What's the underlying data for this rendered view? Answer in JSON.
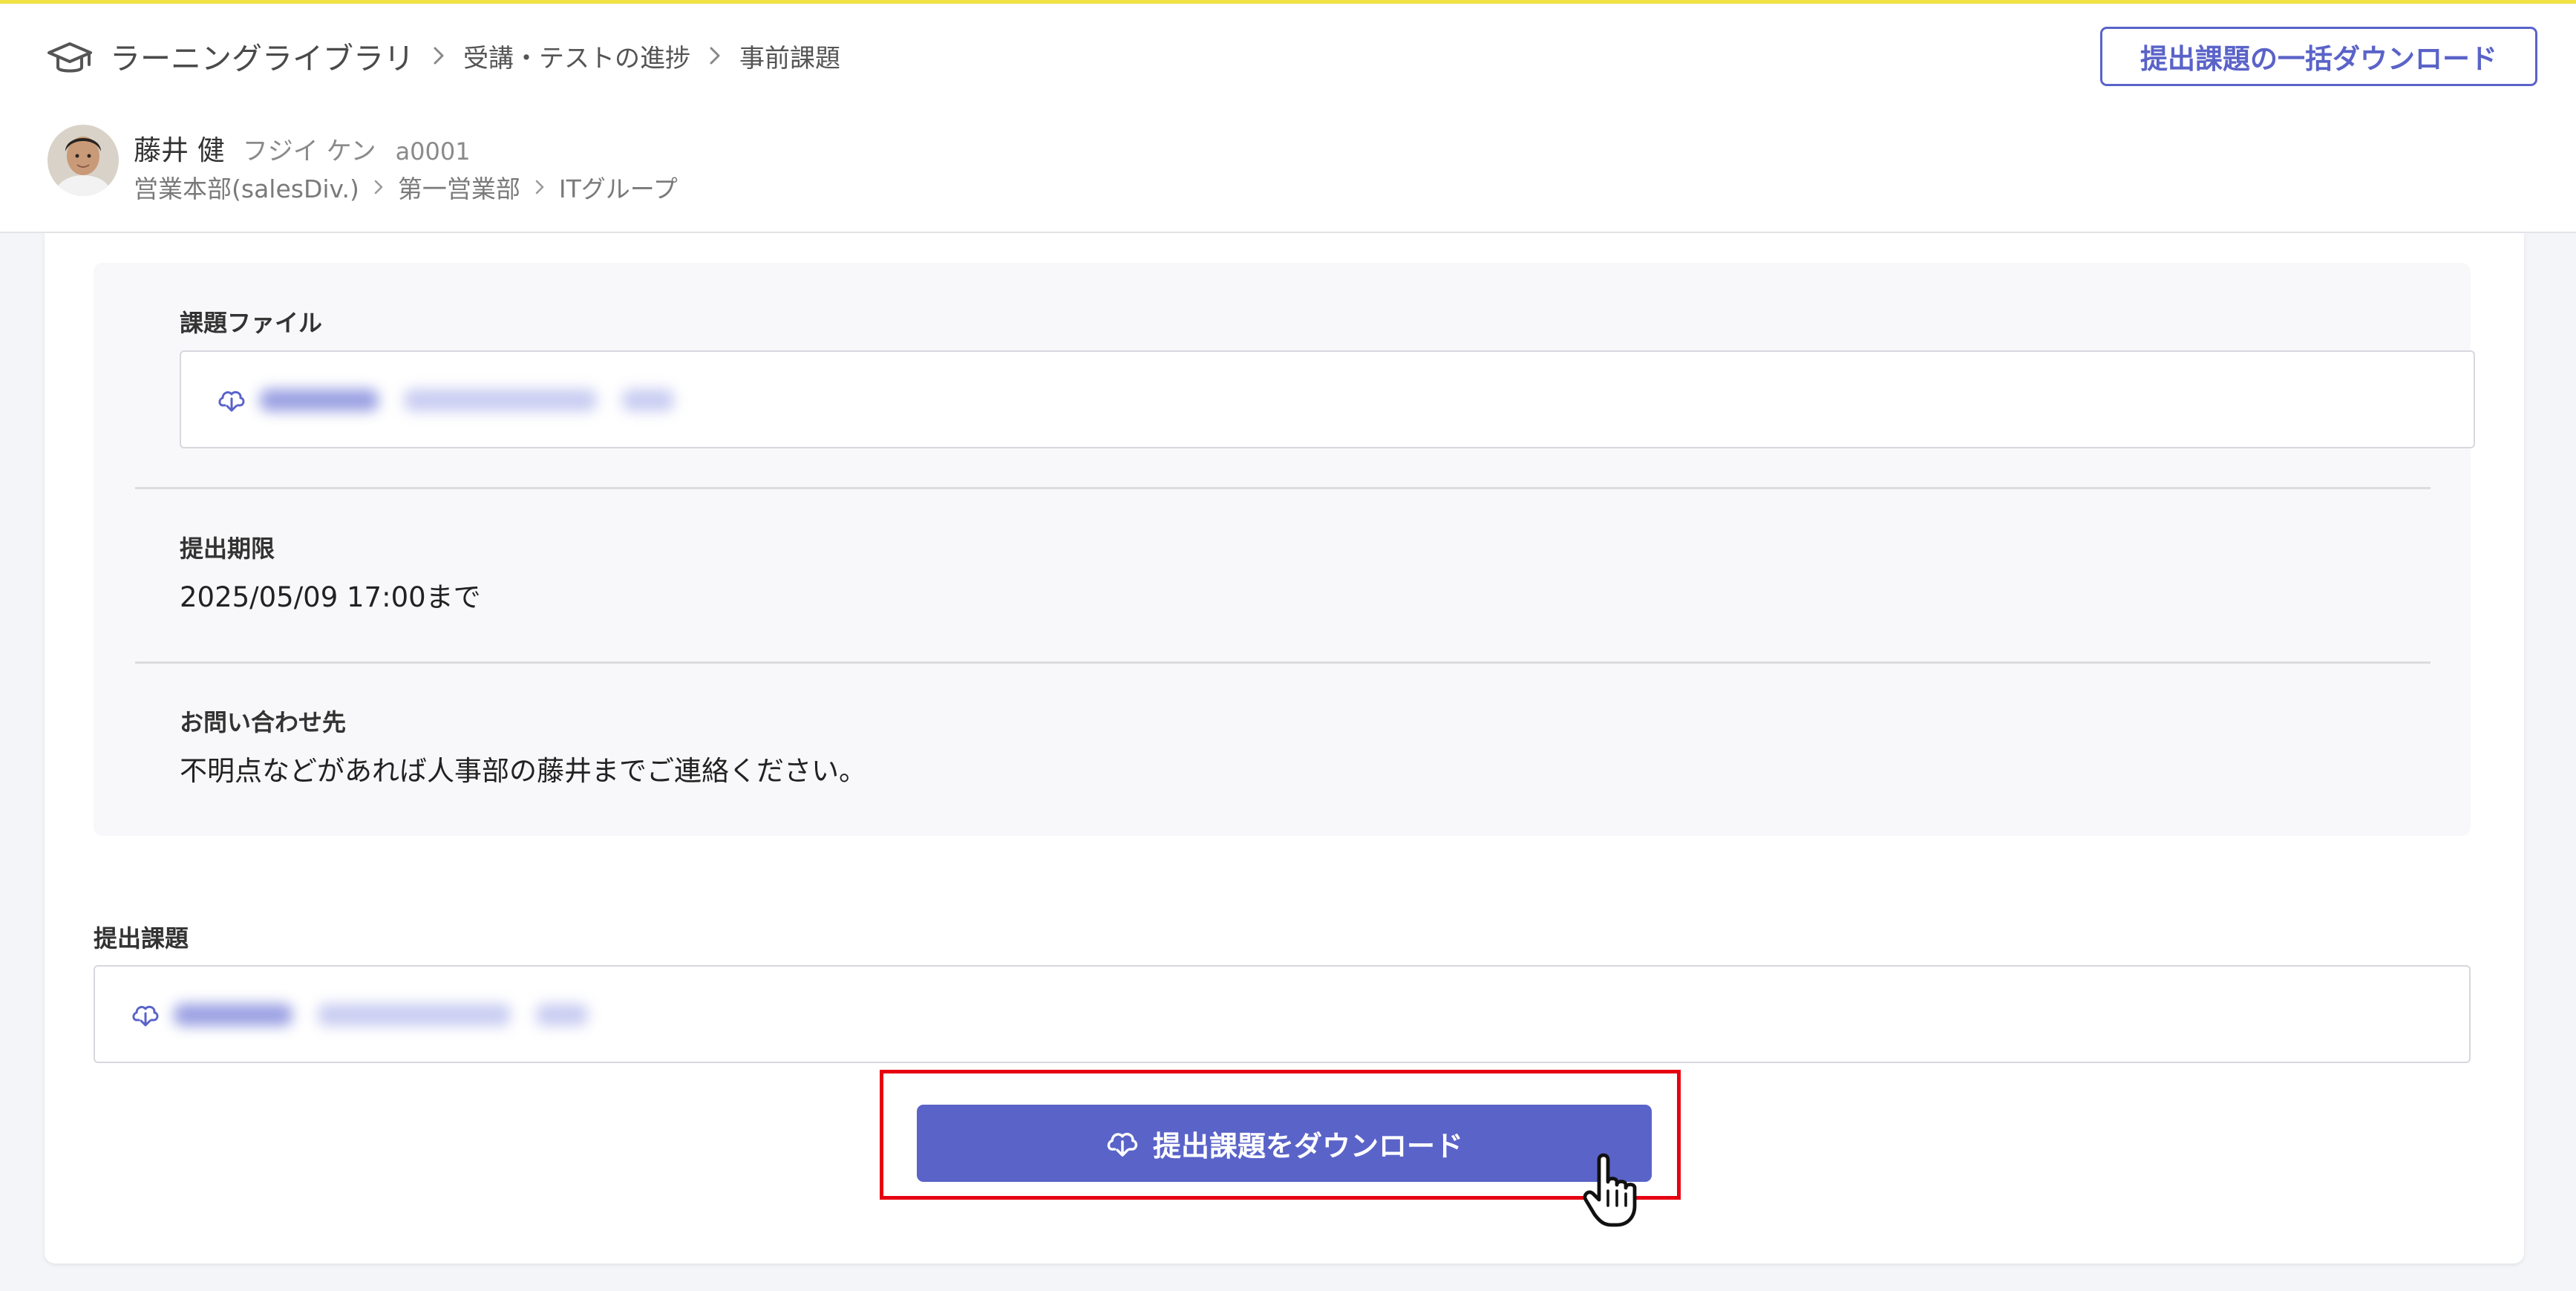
{
  "header": {
    "breadcrumb": [
      "ラーニングライブラリ",
      "受講・テストの進捗",
      "事前課題"
    ],
    "bulk_download_label": "提出課題の一括ダウンロード"
  },
  "user": {
    "name": "藤井 健",
    "kana": "フジイ ケン",
    "id": "a0001",
    "org_path": [
      "営業本部(salesDiv.)",
      "第一営業部",
      "ITグループ"
    ]
  },
  "assignment": {
    "file_label": "課題ファイル",
    "deadline_label": "提出期限",
    "deadline_value": "2025/05/09 17:00まで",
    "contact_label": "お問い合わせ先",
    "contact_value": "不明点などがあれば人事部の藤井までご連絡ください。"
  },
  "submission": {
    "label": "提出課題",
    "download_button_label": "提出課題をダウンロード"
  },
  "icons": {
    "brand": "graduation-cap-icon",
    "separator": "chevron-right-icon",
    "download": "cloud-download-icon",
    "cursor": "hand-pointer-icon"
  },
  "colors": {
    "accent": "#5a63c8",
    "top_border": "#f1e245",
    "highlight": "#e60012",
    "page_background": "#f4f5f8",
    "panel_background": "#f8f8fa"
  }
}
